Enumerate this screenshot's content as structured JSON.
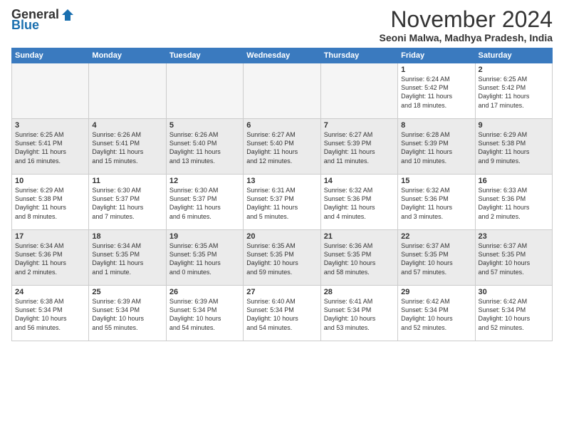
{
  "header": {
    "logo_general": "General",
    "logo_blue": "Blue",
    "title": "November 2024",
    "location": "Seoni Malwa, Madhya Pradesh, India"
  },
  "weekdays": [
    "Sunday",
    "Monday",
    "Tuesday",
    "Wednesday",
    "Thursday",
    "Friday",
    "Saturday"
  ],
  "weeks": [
    [
      {
        "day": "",
        "info": "",
        "empty": true
      },
      {
        "day": "",
        "info": "",
        "empty": true
      },
      {
        "day": "",
        "info": "",
        "empty": true
      },
      {
        "day": "",
        "info": "",
        "empty": true
      },
      {
        "day": "",
        "info": "",
        "empty": true
      },
      {
        "day": "1",
        "info": "Sunrise: 6:24 AM\nSunset: 5:42 PM\nDaylight: 11 hours\nand 18 minutes."
      },
      {
        "day": "2",
        "info": "Sunrise: 6:25 AM\nSunset: 5:42 PM\nDaylight: 11 hours\nand 17 minutes."
      }
    ],
    [
      {
        "day": "3",
        "info": "Sunrise: 6:25 AM\nSunset: 5:41 PM\nDaylight: 11 hours\nand 16 minutes."
      },
      {
        "day": "4",
        "info": "Sunrise: 6:26 AM\nSunset: 5:41 PM\nDaylight: 11 hours\nand 15 minutes."
      },
      {
        "day": "5",
        "info": "Sunrise: 6:26 AM\nSunset: 5:40 PM\nDaylight: 11 hours\nand 13 minutes."
      },
      {
        "day": "6",
        "info": "Sunrise: 6:27 AM\nSunset: 5:40 PM\nDaylight: 11 hours\nand 12 minutes."
      },
      {
        "day": "7",
        "info": "Sunrise: 6:27 AM\nSunset: 5:39 PM\nDaylight: 11 hours\nand 11 minutes."
      },
      {
        "day": "8",
        "info": "Sunrise: 6:28 AM\nSunset: 5:39 PM\nDaylight: 11 hours\nand 10 minutes."
      },
      {
        "day": "9",
        "info": "Sunrise: 6:29 AM\nSunset: 5:38 PM\nDaylight: 11 hours\nand 9 minutes."
      }
    ],
    [
      {
        "day": "10",
        "info": "Sunrise: 6:29 AM\nSunset: 5:38 PM\nDaylight: 11 hours\nand 8 minutes."
      },
      {
        "day": "11",
        "info": "Sunrise: 6:30 AM\nSunset: 5:37 PM\nDaylight: 11 hours\nand 7 minutes."
      },
      {
        "day": "12",
        "info": "Sunrise: 6:30 AM\nSunset: 5:37 PM\nDaylight: 11 hours\nand 6 minutes."
      },
      {
        "day": "13",
        "info": "Sunrise: 6:31 AM\nSunset: 5:37 PM\nDaylight: 11 hours\nand 5 minutes."
      },
      {
        "day": "14",
        "info": "Sunrise: 6:32 AM\nSunset: 5:36 PM\nDaylight: 11 hours\nand 4 minutes."
      },
      {
        "day": "15",
        "info": "Sunrise: 6:32 AM\nSunset: 5:36 PM\nDaylight: 11 hours\nand 3 minutes."
      },
      {
        "day": "16",
        "info": "Sunrise: 6:33 AM\nSunset: 5:36 PM\nDaylight: 11 hours\nand 2 minutes."
      }
    ],
    [
      {
        "day": "17",
        "info": "Sunrise: 6:34 AM\nSunset: 5:36 PM\nDaylight: 11 hours\nand 2 minutes."
      },
      {
        "day": "18",
        "info": "Sunrise: 6:34 AM\nSunset: 5:35 PM\nDaylight: 11 hours\nand 1 minute."
      },
      {
        "day": "19",
        "info": "Sunrise: 6:35 AM\nSunset: 5:35 PM\nDaylight: 11 hours\nand 0 minutes."
      },
      {
        "day": "20",
        "info": "Sunrise: 6:35 AM\nSunset: 5:35 PM\nDaylight: 10 hours\nand 59 minutes."
      },
      {
        "day": "21",
        "info": "Sunrise: 6:36 AM\nSunset: 5:35 PM\nDaylight: 10 hours\nand 58 minutes."
      },
      {
        "day": "22",
        "info": "Sunrise: 6:37 AM\nSunset: 5:35 PM\nDaylight: 10 hours\nand 57 minutes."
      },
      {
        "day": "23",
        "info": "Sunrise: 6:37 AM\nSunset: 5:35 PM\nDaylight: 10 hours\nand 57 minutes."
      }
    ],
    [
      {
        "day": "24",
        "info": "Sunrise: 6:38 AM\nSunset: 5:34 PM\nDaylight: 10 hours\nand 56 minutes."
      },
      {
        "day": "25",
        "info": "Sunrise: 6:39 AM\nSunset: 5:34 PM\nDaylight: 10 hours\nand 55 minutes."
      },
      {
        "day": "26",
        "info": "Sunrise: 6:39 AM\nSunset: 5:34 PM\nDaylight: 10 hours\nand 54 minutes."
      },
      {
        "day": "27",
        "info": "Sunrise: 6:40 AM\nSunset: 5:34 PM\nDaylight: 10 hours\nand 54 minutes."
      },
      {
        "day": "28",
        "info": "Sunrise: 6:41 AM\nSunset: 5:34 PM\nDaylight: 10 hours\nand 53 minutes."
      },
      {
        "day": "29",
        "info": "Sunrise: 6:42 AM\nSunset: 5:34 PM\nDaylight: 10 hours\nand 52 minutes."
      },
      {
        "day": "30",
        "info": "Sunrise: 6:42 AM\nSunset: 5:34 PM\nDaylight: 10 hours\nand 52 minutes."
      }
    ]
  ]
}
